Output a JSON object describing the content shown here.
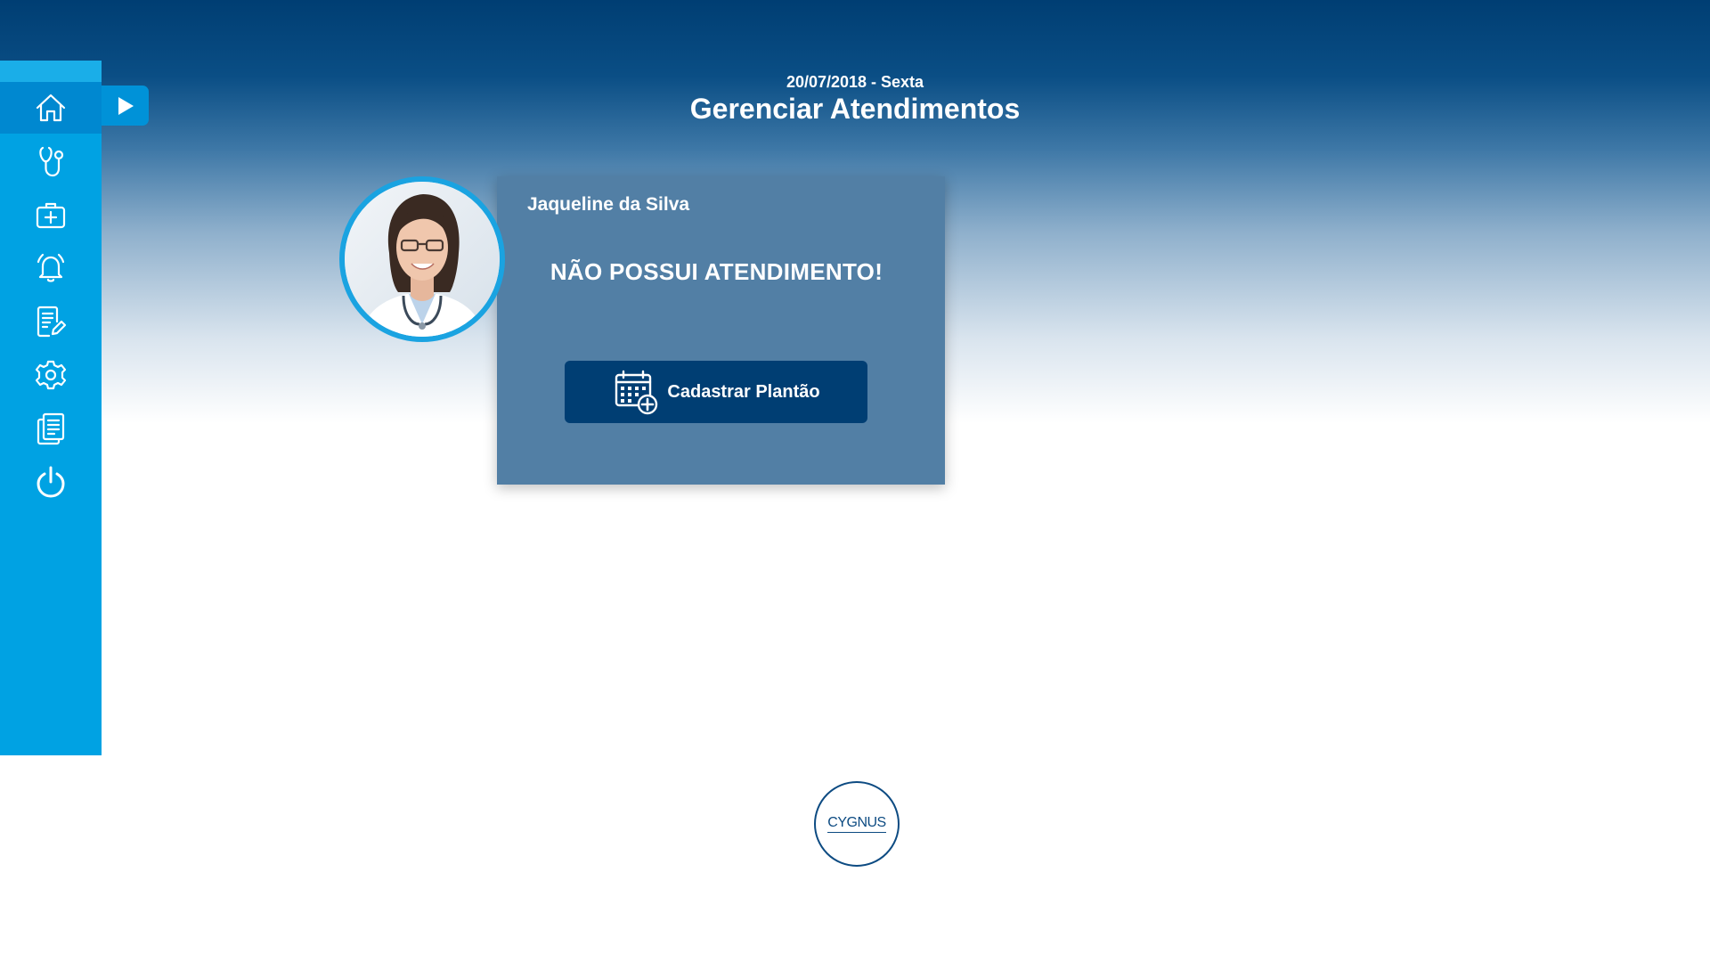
{
  "header": {
    "date": "20/07/2018 - Sexta",
    "title": "Gerenciar Atendimentos"
  },
  "sidebar": {
    "items": [
      {
        "icon": "home-icon",
        "active": true
      },
      {
        "icon": "stethoscope-icon",
        "active": false
      },
      {
        "icon": "medical-kit-icon",
        "active": false
      },
      {
        "icon": "bell-icon",
        "active": false
      },
      {
        "icon": "document-edit-icon",
        "active": false
      },
      {
        "icon": "gear-icon",
        "active": false
      },
      {
        "icon": "documents-icon",
        "active": false
      },
      {
        "icon": "power-icon",
        "active": false
      }
    ],
    "expand_icon": "play-arrow-icon"
  },
  "card": {
    "name": "Jaqueline da Silva",
    "message": "NÃO POSSUI ATENDIMENTO!",
    "button_label": "Cadastrar Plantão",
    "button_icon": "calendar-add-icon"
  },
  "logo": {
    "text": "CYGNUS"
  },
  "colors": {
    "sidebar": "#00a2e3",
    "sidebar_active": "#0088d0",
    "header_dark": "#003e73",
    "card_bg": "#527fa5",
    "button_bg": "#003e73",
    "avatar_border": "#1aa3e1"
  }
}
